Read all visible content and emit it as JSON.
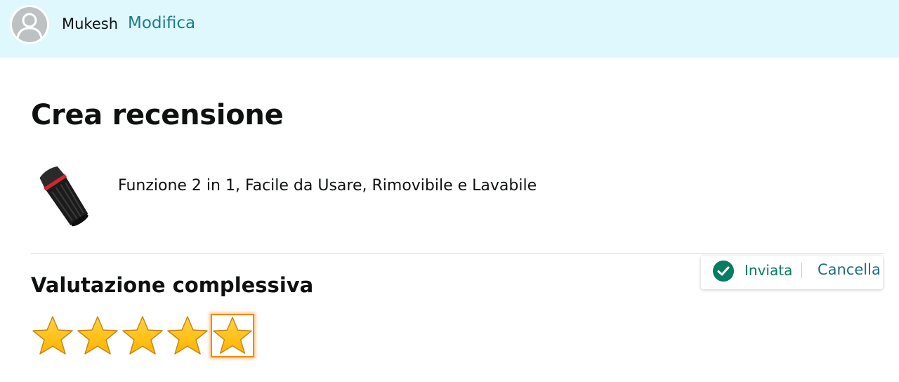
{
  "header": {
    "username": "Mukesh",
    "edit_label": "Modifica",
    "avatar_icon": "user-avatar-icon"
  },
  "page": {
    "title": "Crea recensione"
  },
  "product": {
    "title": "Funzione 2 in 1, Facile da Usare, Rimovibile e Lavabile",
    "image_icon": "product-thumbnail"
  },
  "rating": {
    "section_title": "Valutazione complessiva",
    "value": 5,
    "max": 5,
    "star_color": "#ffb400",
    "focus_color": "#f08804"
  },
  "toast": {
    "status_label": "Inviata",
    "cancel_label": "Cancella",
    "status_icon": "check-circle-icon",
    "status_color": "#067d62"
  }
}
